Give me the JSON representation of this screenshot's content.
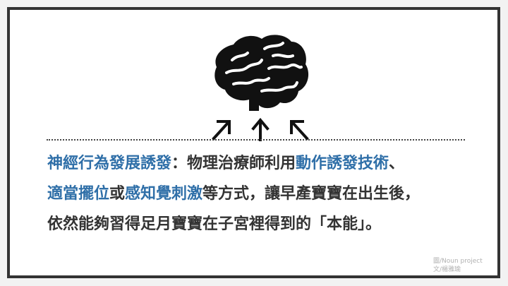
{
  "slide": {
    "icon": "brain-icon",
    "arrow_icons": [
      "arrow-up-left-icon",
      "arrow-up-icon",
      "arrow-up-right-icon"
    ],
    "colors": {
      "text": "#333333",
      "highlight": "#2f6fa8",
      "frame": "#333333",
      "credit": "#b0b0b0"
    },
    "lines": [
      {
        "segments": [
          {
            "text": "神經行為發展誘發",
            "highlight": true
          },
          {
            "text": "：物理治療師利用",
            "highlight": false
          },
          {
            "text": "動作誘發技術",
            "highlight": true
          },
          {
            "text": "、",
            "highlight": false
          }
        ]
      },
      {
        "segments": [
          {
            "text": "適當擺位",
            "highlight": true
          },
          {
            "text": "或",
            "highlight": false
          },
          {
            "text": "感知覺刺激",
            "highlight": true
          },
          {
            "text": "等方式，讓早產寶寶在出生後，",
            "highlight": false
          }
        ]
      },
      {
        "segments": [
          {
            "text": "依然能夠習得足月寶寶在子宮裡得到的「本能」。",
            "highlight": false
          }
        ]
      }
    ],
    "credit": {
      "line1": "圖/Noun project",
      "line2": "文/楊雅瑜"
    }
  }
}
